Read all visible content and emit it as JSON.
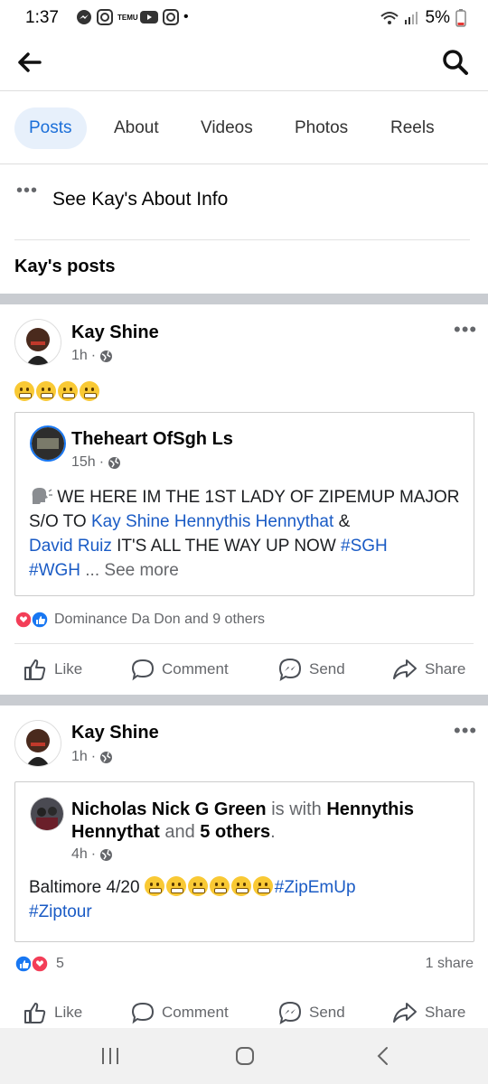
{
  "status_bar": {
    "time": "1:37",
    "battery": "5%",
    "dot": "•",
    "temu_label": "TEMU"
  },
  "tabs": [
    {
      "label": "Posts"
    },
    {
      "label": "About"
    },
    {
      "label": "Videos"
    },
    {
      "label": "Photos"
    },
    {
      "label": "Reels"
    }
  ],
  "about": {
    "label": "See Kay's About Info"
  },
  "section_title": "Kay's posts",
  "post1": {
    "author": "Kay Shine",
    "time": "1h",
    "shared": {
      "author": "Theheart OfSgh Ls",
      "time": "15h",
      "text_a": "WE HERE IM THE 1ST LADY OF ZIPEMUP MAJOR S/O TO",
      "link1": "Kay Shine Hennythis Hennythat",
      "text_b": "&",
      "link2": "David Ruiz",
      "text_c": "IT'S ALL THE WAY UP NOW",
      "tag1": "#SGH",
      "tag2": "#WGH",
      "see_more": "... See more"
    },
    "reactions": "Dominance Da Don and 9 others"
  },
  "actions": {
    "like": "Like",
    "comment": "Comment",
    "send": "Send",
    "share": "Share"
  },
  "post2": {
    "author": "Kay Shine",
    "time": "1h",
    "shared": {
      "author": "Nicholas Nick G Green",
      "with_word": "is with",
      "tagged": "Hennythis Hennythat",
      "and_word": "and",
      "others": "5 others",
      "period": ".",
      "time": "4h",
      "text": "Baltimore 4/20",
      "tag1": "#ZipEmUp",
      "tag2": "#Ziptour"
    },
    "reaction_count": "5",
    "shares": "1 share"
  }
}
